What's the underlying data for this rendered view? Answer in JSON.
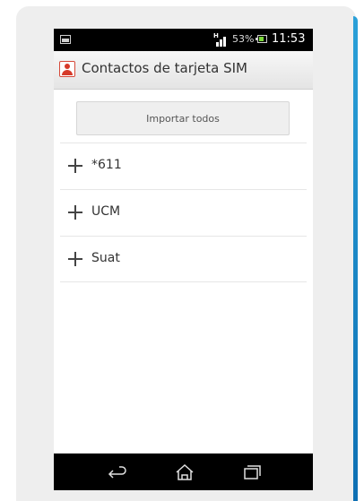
{
  "status_bar": {
    "signal_badge": "H",
    "battery_percent": "53%",
    "time": "11:53",
    "battery_color": "#7bd83a"
  },
  "action_bar": {
    "title": "Contactos de tarjeta SIM",
    "icon": "contact-card-icon"
  },
  "import_button": {
    "label": "Importar todos"
  },
  "contacts": [
    {
      "name": "*611"
    },
    {
      "name": "UCM"
    },
    {
      "name": "Suat"
    }
  ],
  "nav_bar": {
    "back": "back-icon",
    "home": "home-icon",
    "recents": "recents-icon"
  },
  "colors": {
    "frame_accent": "#1b86c6",
    "status_bar_bg": "#000000",
    "contact_icon": "#d63a2a"
  }
}
